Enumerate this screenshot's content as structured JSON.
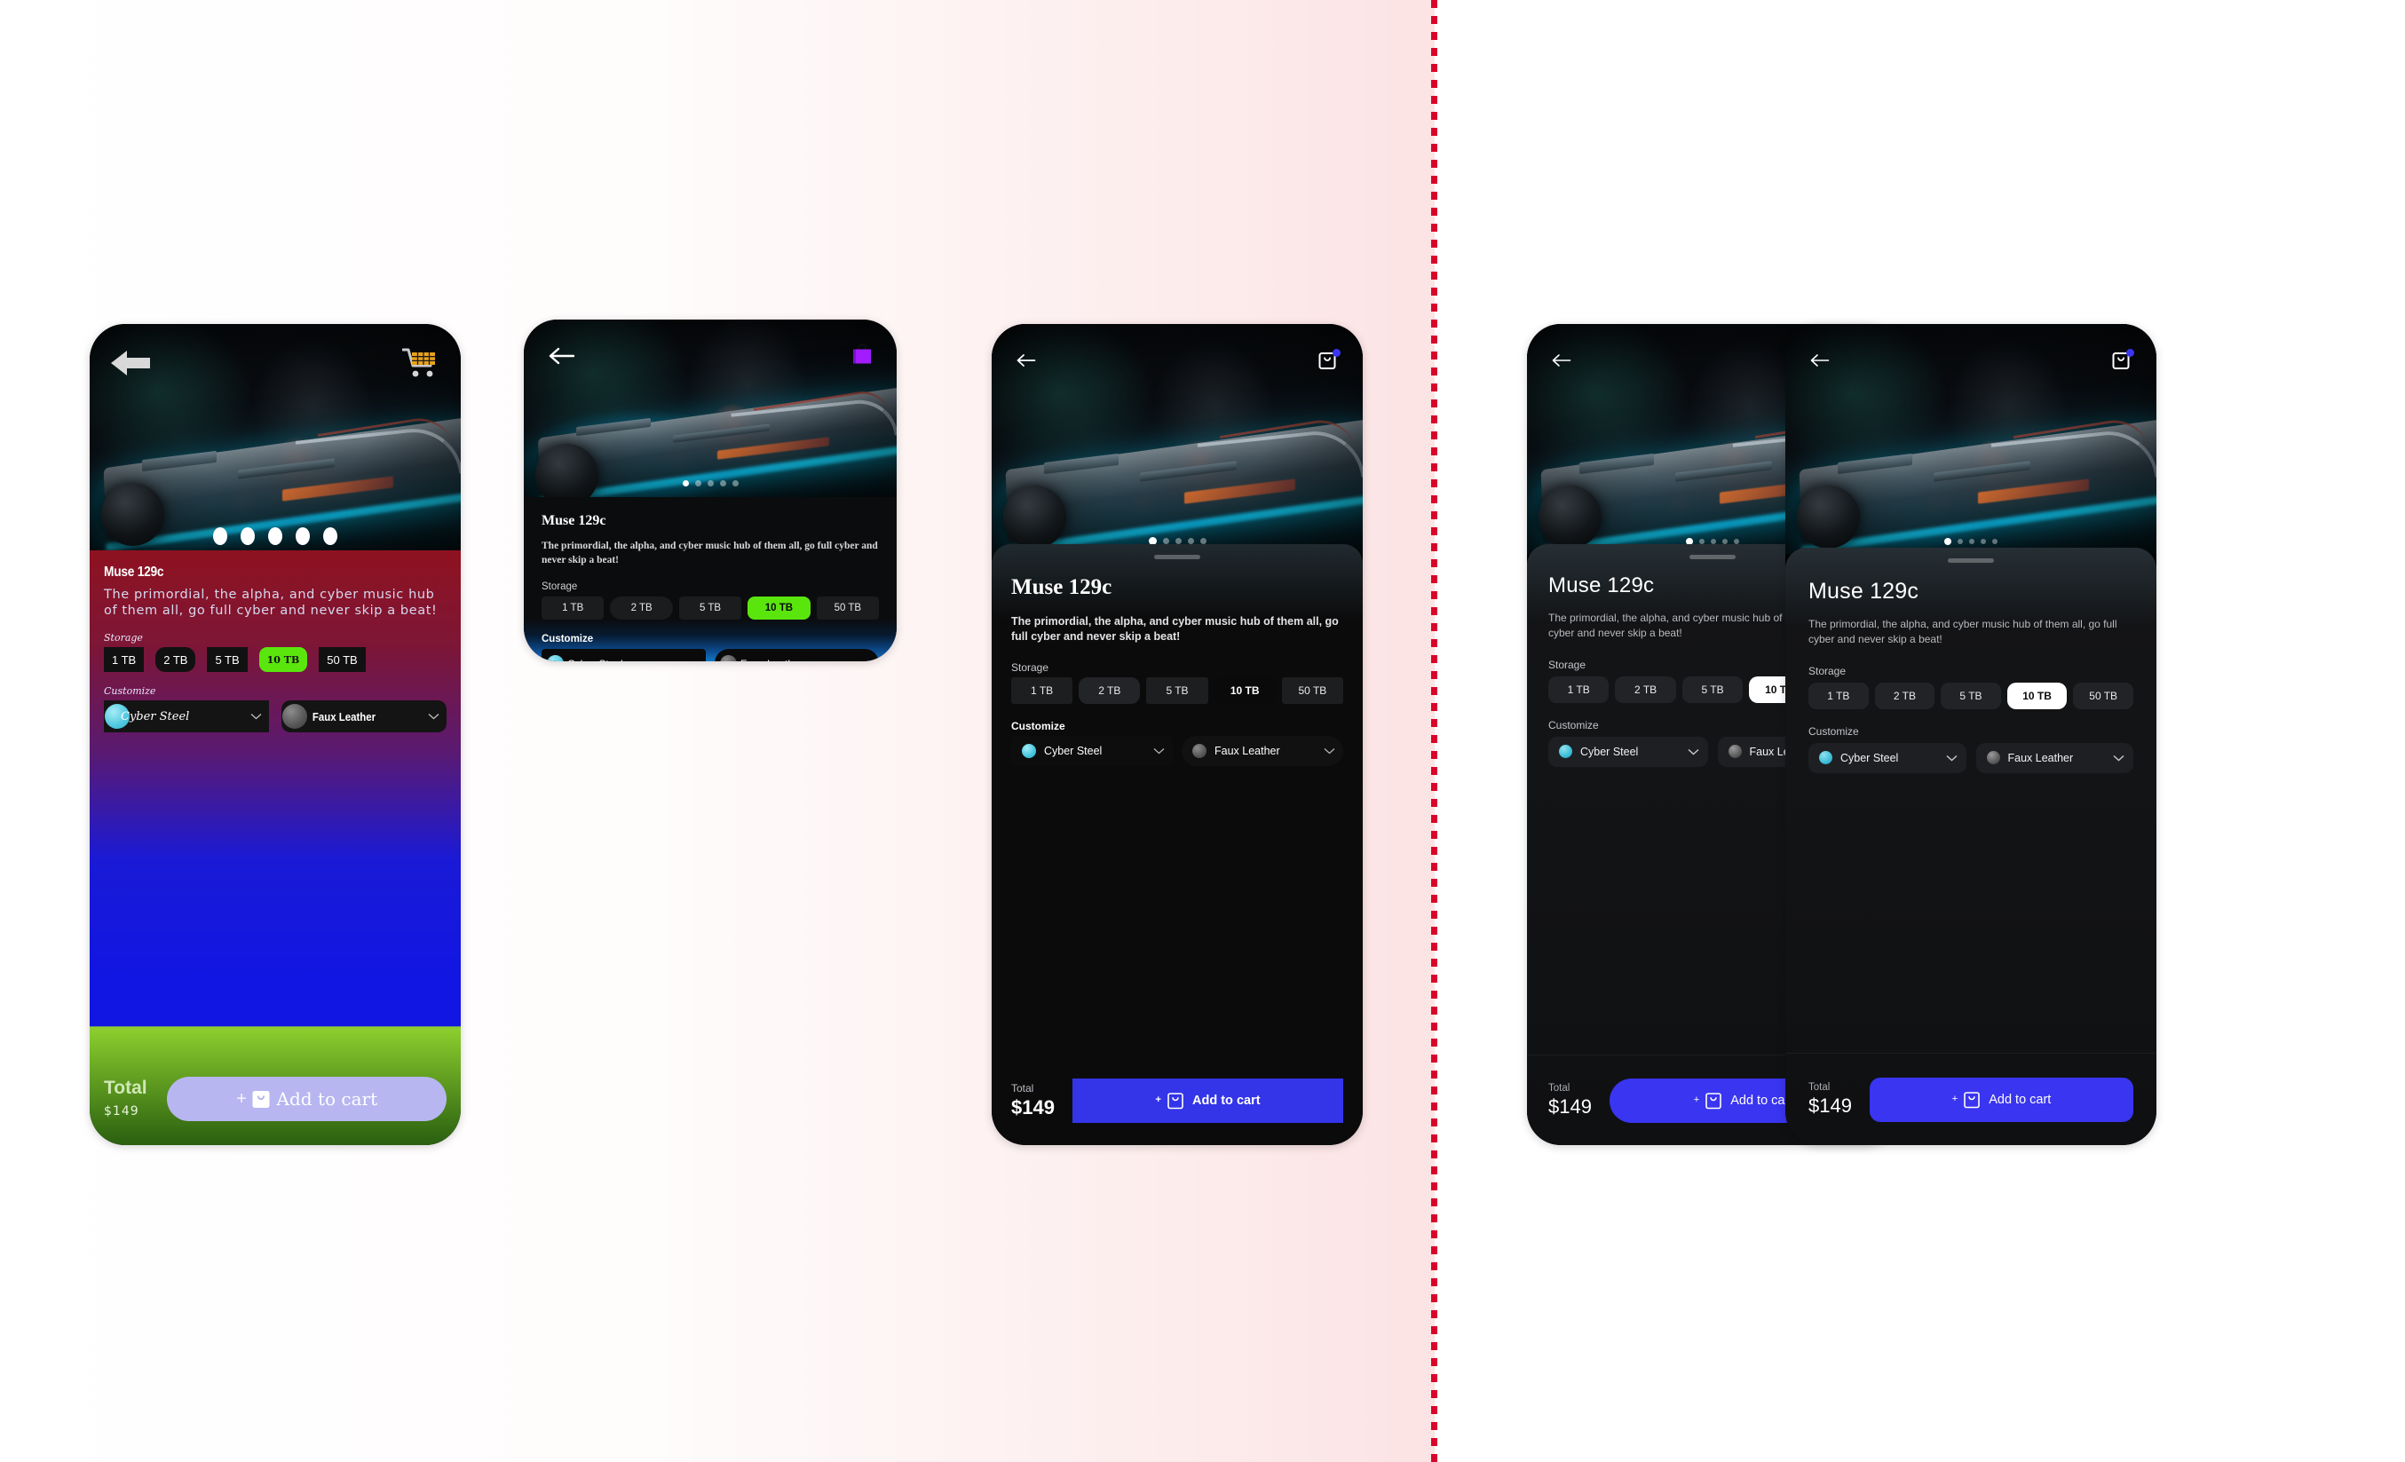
{
  "canvas": {
    "background_left": "#ffffff",
    "background_right_tint": "#fce3e4",
    "divider_color": "#d9042b",
    "divider_style": "vertical-dotted"
  },
  "product": {
    "title": "Muse 129c",
    "description": "The primordial, the alpha, and cyber music hub of them all, go full cyber and never skip a beat!",
    "storage_label": "Storage",
    "storage_options": [
      "1 TB",
      "2 TB",
      "5 TB",
      "10 TB",
      "50 TB"
    ],
    "storage_selected": "10 TB",
    "customize_label": "Customize",
    "material_options": [
      {
        "name": "Cyber Steel",
        "swatch": "#4fc8df"
      },
      {
        "name": "Faux Leather",
        "swatch": "#5c5c5c"
      }
    ],
    "total_label": "Total",
    "total_value": "$149",
    "cta_label": "Add to cart",
    "cta_plus": "+"
  },
  "screens": [
    {
      "id": "screen-1",
      "variant": "unstyled-draft",
      "back_icon": "back-arrow-icon",
      "cart_icon": "shopping-cart-icon",
      "cart_badge": "",
      "accent_chip": "#5ae60d",
      "cta_bg": "#b7b6f0",
      "carousel_dots": 5,
      "carousel_active_index": 2
    },
    {
      "id": "screen-2",
      "variant": "serif-blue-gradient",
      "back_icon": "back-arrow-icon",
      "cart_icon": "shopping-bag-icon",
      "cart_badge": "",
      "accent_chip": "#5ae60d",
      "cta_bg": "#1a1ae8",
      "carousel_dots": 5,
      "carousel_active_index": 0
    },
    {
      "id": "screen-3",
      "variant": "serif-dark",
      "back_icon": "back-arrow-icon",
      "cart_icon": "shopping-bag-icon",
      "cart_badge": "dot",
      "accent_chip": "#0a0a0b",
      "cta_bg": "#3434e8",
      "carousel_dots": 5,
      "carousel_active_index": 0
    },
    {
      "id": "screen-4",
      "variant": "refined-pill",
      "back_icon": "back-arrow-icon",
      "cart_icon": "shopping-bag-icon",
      "cart_badge": "dot",
      "accent_chip": "#ffffff",
      "cta_bg": "#3a35f0",
      "carousel_dots": 5,
      "carousel_active_index": 0
    },
    {
      "id": "screen-5",
      "variant": "refined-rounded",
      "back_icon": "back-arrow-icon",
      "cart_icon": "shopping-bag-icon",
      "cart_badge": "dot",
      "accent_chip": "#ffffff",
      "cta_bg": "#3a35f0",
      "carousel_dots": 5,
      "carousel_active_index": 0
    }
  ]
}
